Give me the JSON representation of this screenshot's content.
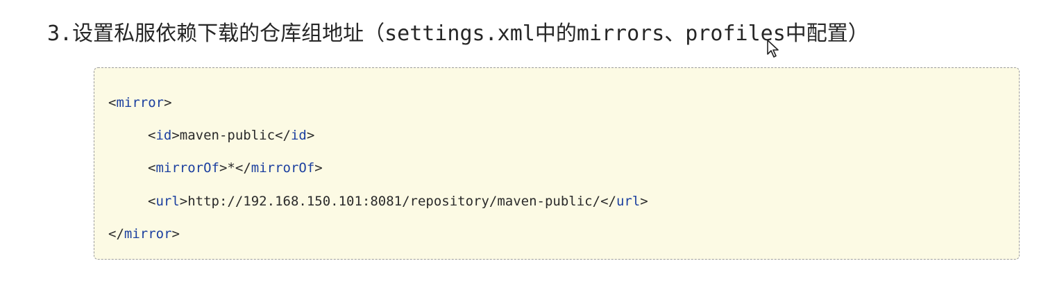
{
  "heading": {
    "text": "3.设置私服依赖下载的仓库组地址（settings.xml中的mirrors、profiles中配置）"
  },
  "code": {
    "lines": [
      {
        "open": "<",
        "tag": "mirror",
        "close": ">",
        "body": "",
        "endOpen": "",
        "endTag": "",
        "endClose": ""
      },
      {
        "open": "<",
        "tag": "id",
        "close": ">",
        "body": "maven-public",
        "endOpen": "</",
        "endTag": "id",
        "endClose": ">"
      },
      {
        "open": "<",
        "tag": "mirrorOf",
        "close": ">",
        "body": "*",
        "endOpen": "</",
        "endTag": "mirrorOf",
        "endClose": ">"
      },
      {
        "open": "<",
        "tag": "url",
        "close": ">",
        "body": "http://192.168.150.101:8081/repository/maven-public/",
        "endOpen": "</",
        "endTag": "url",
        "endClose": ">"
      },
      {
        "open": "</",
        "tag": "mirror",
        "close": ">",
        "body": "",
        "endOpen": "",
        "endTag": "",
        "endClose": ""
      }
    ]
  },
  "colors": {
    "tag": "#1b3f9f",
    "text": "#2a2a2a",
    "code_background": "#fcfae4"
  },
  "icons": {
    "pointer": "mouse-cursor-icon"
  }
}
